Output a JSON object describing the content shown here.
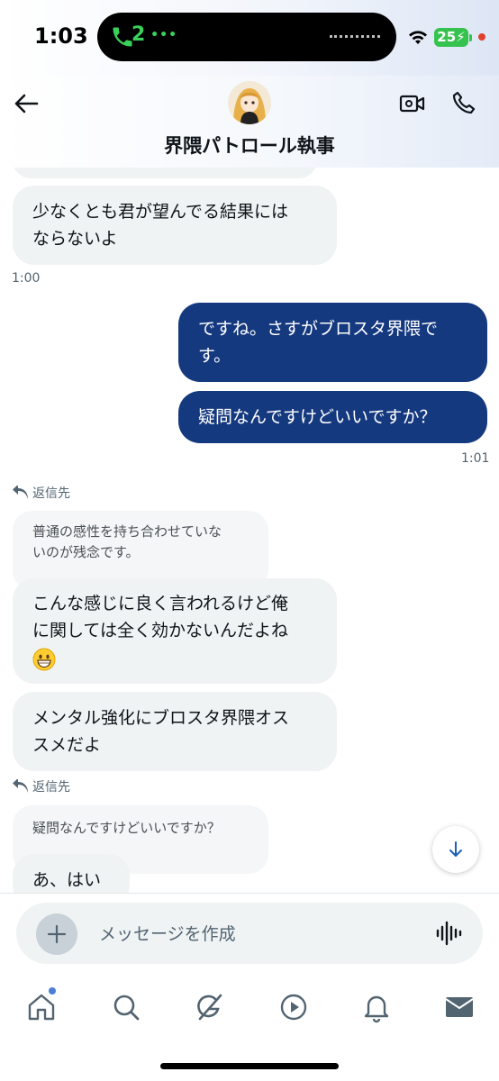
{
  "status_bar": {
    "time": "1:03",
    "call_count": "2",
    "battery": "25"
  },
  "header": {
    "title": "界隈パトロール執事"
  },
  "messages": [
    {
      "id": "m1",
      "side": "received",
      "lines": [
        "少なくとも君が望んでる結果には",
        "ならないよ"
      ]
    },
    {
      "id": "t1",
      "time": "1:00"
    },
    {
      "id": "m2",
      "side": "sent",
      "lines": [
        "ですね。さすがブロスタ界隈で",
        "す。"
      ]
    },
    {
      "id": "m3",
      "side": "sent",
      "lines": [
        "疑問なんですけどいいですか？"
      ]
    },
    {
      "id": "t2",
      "time": "1:01"
    },
    {
      "id": "r1",
      "reply_label": "返信先",
      "quote_lines": [
        "普通の感性を持ち合わせていな",
        "いのが残念です。"
      ]
    },
    {
      "id": "m4",
      "side": "received",
      "lines": [
        "こんな感じに良く言われるけど俺",
        "に関しては全く効かないんだよね"
      ],
      "emoji": "grinning-face-emoji"
    },
    {
      "id": "m5",
      "side": "received",
      "lines": [
        "メンタル強化にブロスタ界隈オス",
        "スメだよ"
      ]
    },
    {
      "id": "r2",
      "reply_label": "返信先",
      "quote_lines": [
        "疑問なんですけどいいですか？"
      ]
    },
    {
      "id": "m6",
      "side": "received",
      "lines": [
        "あ、はい"
      ]
    }
  ],
  "composer": {
    "placeholder": "メッセージを作成"
  },
  "nav": {
    "items": [
      "home-icon",
      "search-icon",
      "grok-icon",
      "video-play-icon",
      "bell-icon",
      "mail-icon"
    ]
  },
  "colors": {
    "sent_bubble": "#15397f",
    "received_bubble": "#eff3f4",
    "accent": "#1d9bf0"
  }
}
